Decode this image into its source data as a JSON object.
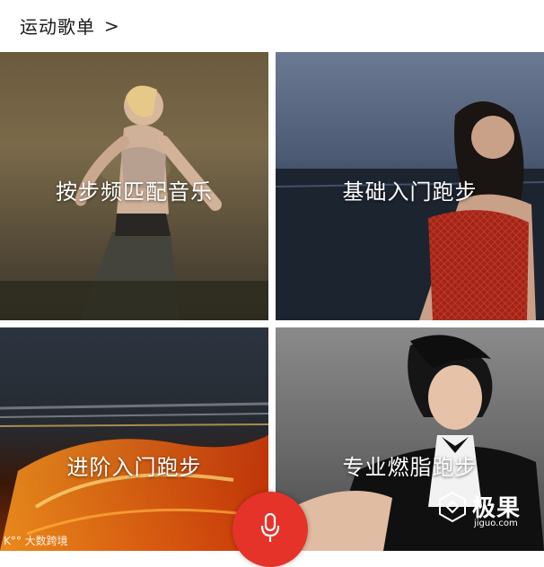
{
  "header": {
    "title": "运动歌单",
    "chevron": ">"
  },
  "cards": [
    {
      "label": "按步频匹配音乐"
    },
    {
      "label": "基础入门跑步"
    },
    {
      "label": "进阶入门跑步"
    },
    {
      "label": "专业燃脂跑步"
    }
  ],
  "mic": {
    "icon": "microphone-icon",
    "color": "#e5332a"
  },
  "watermarks": {
    "left": "K°° 大数跨境",
    "right_big": "极果",
    "right_small": "jiguo.com"
  }
}
